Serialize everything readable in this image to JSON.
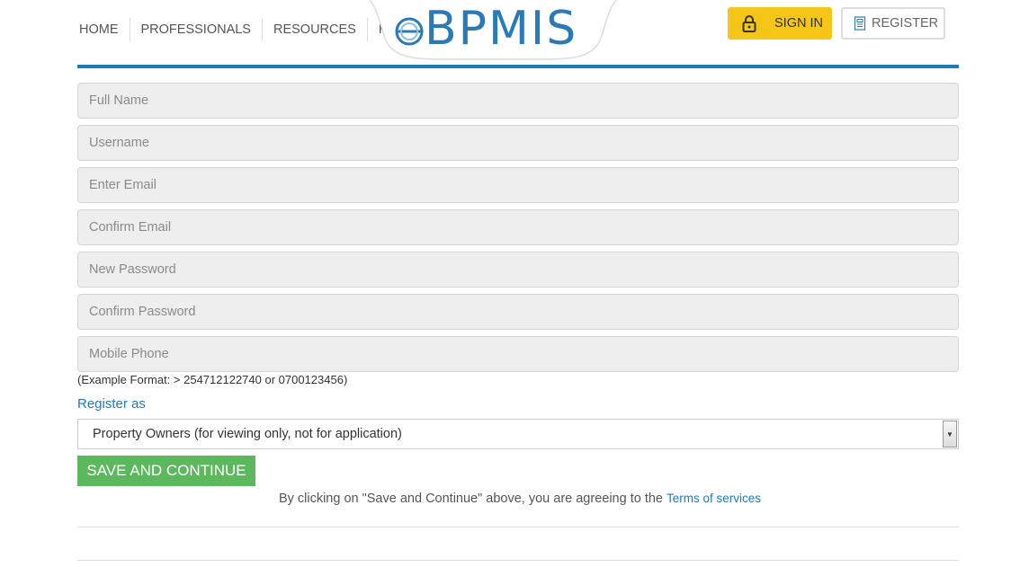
{
  "nav": {
    "items": [
      "HOME",
      "PROFESSIONALS",
      "RESOURCES",
      "REF"
    ]
  },
  "logo": {
    "text": "eBPMIS",
    "icon": "ebpmis-logo"
  },
  "header": {
    "signin_label": "SIGN IN",
    "register_label": "REGISTER",
    "signin_icon": "lock-icon",
    "register_icon": "document-icon"
  },
  "form": {
    "fields": [
      {
        "placeholder": "Full Name",
        "value": ""
      },
      {
        "placeholder": "Username",
        "value": ""
      },
      {
        "placeholder": "Enter Email",
        "value": ""
      },
      {
        "placeholder": "Confirm Email",
        "value": ""
      },
      {
        "placeholder": "New Password",
        "value": ""
      },
      {
        "placeholder": "Confirm Password",
        "value": ""
      },
      {
        "placeholder": "Mobile Phone",
        "value": ""
      }
    ],
    "phone_hint": "(Example Format: > 254712122740 or 0700123456)",
    "register_as_label": "Register as",
    "register_as_selected": "Property Owners (for viewing only, not for application)",
    "save_label": "SAVE AND CONTINUE",
    "terms_prefix": "By clicking on \"Save and Continue\" above, you are agreeing to the",
    "terms_link": "Terms of services"
  },
  "colors": {
    "accent": "#1e7ab4",
    "signin_bg": "#f5c518",
    "save_bg": "#5cb85c"
  }
}
